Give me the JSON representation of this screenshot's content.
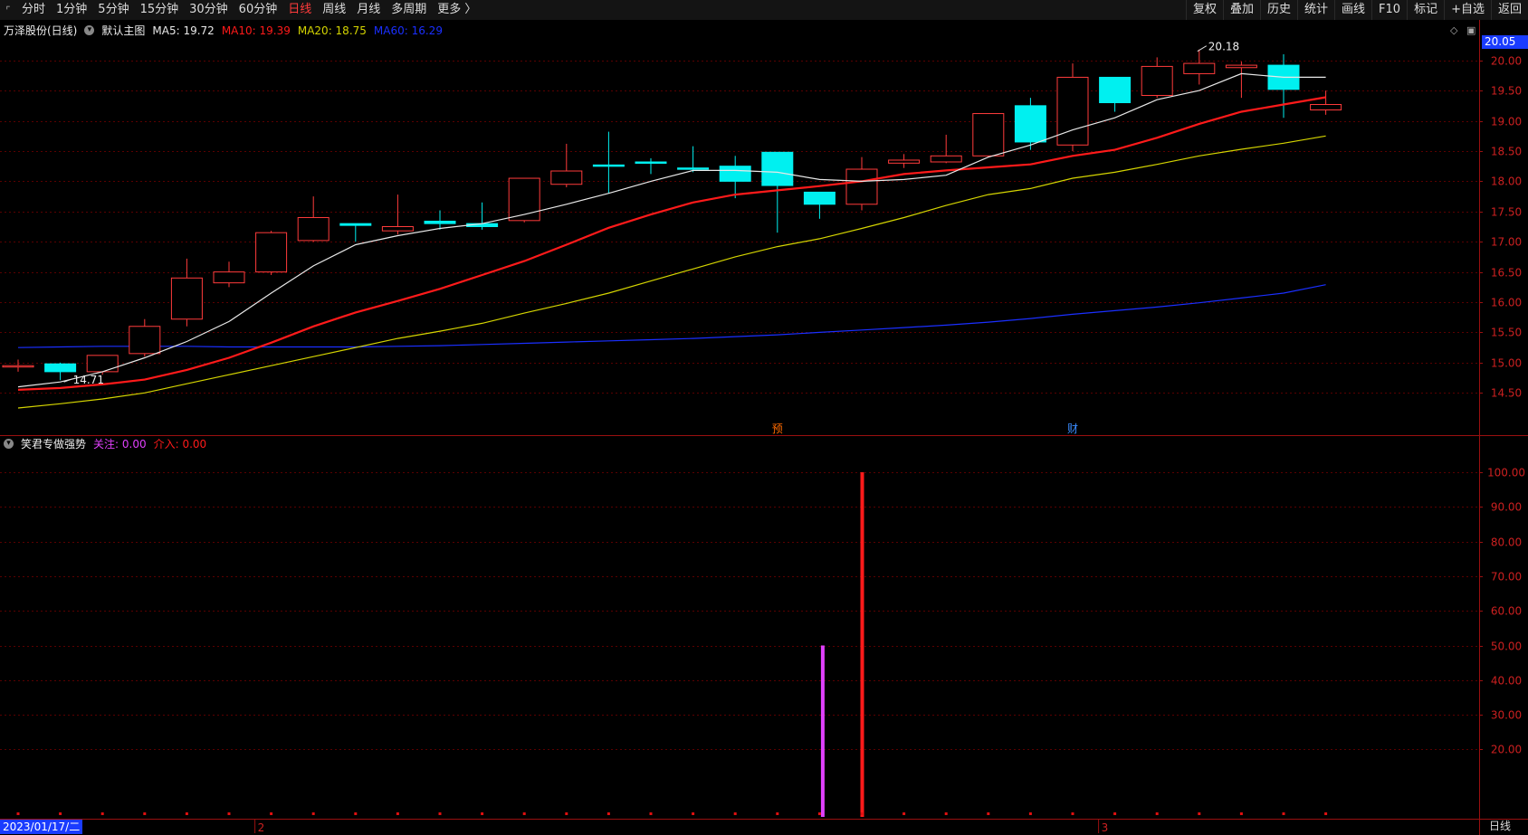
{
  "toolbar": {
    "periods": [
      "分时",
      "1分钟",
      "5分钟",
      "15分钟",
      "30分钟",
      "60分钟",
      "日线",
      "周线",
      "月线",
      "多周期",
      "更多 〉"
    ],
    "active_period": "日线",
    "right_buttons": [
      "复权",
      "叠加",
      "历史",
      "统计",
      "画线",
      "F10",
      "标记",
      "+自选",
      "返回"
    ]
  },
  "header": {
    "stock": "万泽股份(日线)",
    "main_label": "默认主图",
    "ma5": "MA5: 19.72",
    "ma10": "MA10: 19.39",
    "ma20": "MA20: 18.75",
    "ma60": "MA60: 16.29"
  },
  "indicator_header": {
    "name": "笑君专做强势",
    "guanzhu": "关注: 0.00",
    "jieru": "介入: 0.00"
  },
  "price_tag": "20.05",
  "date_tag": "2023/01/17/二",
  "period_label": "日线",
  "colors": {
    "up": "#ff3b3b",
    "down": "#00f0f0",
    "ma5": "#e8e8e8",
    "ma10": "#ff1a1a",
    "ma20": "#d4d400",
    "ma60": "#1a2fff",
    "guanzhu": "#e040fb",
    "jieru": "#ff1a1a",
    "axis": "#9a1010"
  },
  "chart_data": [
    {
      "type": "candlestick",
      "y_ticks": [
        "20.00",
        "19.50",
        "19.00",
        "18.50",
        "18.00",
        "17.50",
        "17.00",
        "16.50",
        "16.00",
        "15.50",
        "15.00",
        "14.50"
      ],
      "ylim": [
        14.1,
        20.4
      ],
      "candles": [
        {
          "o": 14.95,
          "h": 15.05,
          "l": 14.85,
          "c": 14.95
        },
        {
          "o": 14.98,
          "h": 15.0,
          "l": 14.71,
          "c": 14.85
        },
        {
          "o": 14.85,
          "h": 15.12,
          "l": 14.8,
          "c": 15.12
        },
        {
          "o": 15.15,
          "h": 15.72,
          "l": 15.1,
          "c": 15.6
        },
        {
          "o": 15.72,
          "h": 16.72,
          "l": 15.6,
          "c": 16.4
        },
        {
          "o": 16.32,
          "h": 16.67,
          "l": 16.25,
          "c": 16.5
        },
        {
          "o": 16.5,
          "h": 17.18,
          "l": 16.45,
          "c": 17.15
        },
        {
          "o": 17.02,
          "h": 17.75,
          "l": 17.0,
          "c": 17.4
        },
        {
          "o": 17.3,
          "h": 17.3,
          "l": 17.0,
          "c": 17.27
        },
        {
          "o": 17.18,
          "h": 17.78,
          "l": 17.12,
          "c": 17.25
        },
        {
          "o": 17.34,
          "h": 17.52,
          "l": 17.2,
          "c": 17.3
        },
        {
          "o": 17.3,
          "h": 17.65,
          "l": 17.2,
          "c": 17.25
        },
        {
          "o": 17.35,
          "h": 18.05,
          "l": 17.32,
          "c": 18.05
        },
        {
          "o": 17.95,
          "h": 18.62,
          "l": 17.9,
          "c": 18.17
        },
        {
          "o": 18.27,
          "h": 18.82,
          "l": 17.8,
          "c": 18.25
        },
        {
          "o": 18.32,
          "h": 18.38,
          "l": 18.12,
          "c": 18.3
        },
        {
          "o": 18.22,
          "h": 18.58,
          "l": 18.15,
          "c": 18.2
        },
        {
          "o": 18.25,
          "h": 18.42,
          "l": 17.72,
          "c": 18.0
        },
        {
          "o": 18.48,
          "h": 18.48,
          "l": 17.15,
          "c": 17.93
        },
        {
          "o": 17.82,
          "h": 17.82,
          "l": 17.38,
          "c": 17.62
        },
        {
          "o": 17.62,
          "h": 18.4,
          "l": 17.52,
          "c": 18.2
        },
        {
          "o": 18.3,
          "h": 18.45,
          "l": 18.22,
          "c": 18.35
        },
        {
          "o": 18.32,
          "h": 18.77,
          "l": 18.3,
          "c": 18.42
        },
        {
          "o": 18.42,
          "h": 19.12,
          "l": 18.4,
          "c": 19.12
        },
        {
          "o": 19.25,
          "h": 19.38,
          "l": 18.52,
          "c": 18.65
        },
        {
          "o": 18.6,
          "h": 19.95,
          "l": 18.5,
          "c": 19.72
        },
        {
          "o": 19.72,
          "h": 19.72,
          "l": 19.15,
          "c": 19.3
        },
        {
          "o": 19.42,
          "h": 20.05,
          "l": 19.38,
          "c": 19.9
        },
        {
          "o": 19.78,
          "h": 20.18,
          "l": 19.6,
          "c": 19.95
        },
        {
          "o": 19.88,
          "h": 19.98,
          "l": 19.38,
          "c": 19.92
        },
        {
          "o": 19.92,
          "h": 20.1,
          "l": 19.05,
          "c": 19.52
        },
        {
          "o": 19.18,
          "h": 19.5,
          "l": 19.1,
          "c": 19.27
        }
      ],
      "ma5": [
        14.6,
        14.68,
        14.85,
        15.08,
        15.35,
        15.68,
        16.15,
        16.6,
        16.95,
        17.1,
        17.22,
        17.3,
        17.45,
        17.62,
        17.8,
        18.0,
        18.18,
        18.18,
        18.15,
        18.03,
        18.0,
        18.03,
        18.1,
        18.4,
        18.6,
        18.85,
        19.05,
        19.35,
        19.5,
        19.78,
        19.72,
        19.72
      ],
      "ma10": [
        14.55,
        14.58,
        14.64,
        14.72,
        14.88,
        15.08,
        15.33,
        15.6,
        15.83,
        16.02,
        16.22,
        16.45,
        16.68,
        16.95,
        17.23,
        17.45,
        17.65,
        17.78,
        17.85,
        17.92,
        18.0,
        18.12,
        18.18,
        18.23,
        18.28,
        18.42,
        18.52,
        18.72,
        18.95,
        19.15,
        19.27,
        19.39
      ],
      "ma20": [
        14.25,
        14.32,
        14.4,
        14.5,
        14.65,
        14.8,
        14.95,
        15.1,
        15.25,
        15.4,
        15.52,
        15.65,
        15.82,
        15.98,
        16.15,
        16.35,
        16.55,
        16.75,
        16.92,
        17.05,
        17.22,
        17.4,
        17.6,
        17.78,
        17.88,
        18.05,
        18.15,
        18.28,
        18.42,
        18.53,
        18.63,
        18.75
      ],
      "ma60": [
        15.25,
        15.26,
        15.27,
        15.27,
        15.27,
        15.26,
        15.26,
        15.26,
        15.26,
        15.27,
        15.28,
        15.3,
        15.32,
        15.34,
        15.36,
        15.38,
        15.4,
        15.43,
        15.46,
        15.5,
        15.54,
        15.58,
        15.62,
        15.67,
        15.73,
        15.8,
        15.86,
        15.92,
        15.99,
        16.07,
        16.15,
        16.29
      ],
      "annotations": [
        {
          "index": 1,
          "text": "14.71",
          "at": "low"
        },
        {
          "index": 28,
          "text": "20.18",
          "at": "high"
        }
      ],
      "event_marks": [
        {
          "index": 18,
          "text": "预",
          "color": "#ff6a00"
        },
        {
          "index": 25,
          "text": "财",
          "color": "#3a8cff"
        }
      ]
    },
    {
      "type": "bar",
      "title": "笑君专做强势",
      "y_ticks": [
        "100.00",
        "90.00",
        "80.00",
        "70.00",
        "60.00",
        "50.00",
        "40.00",
        "30.00",
        "20.00"
      ],
      "ylim": [
        0,
        100
      ],
      "series": [
        {
          "name": "关注",
          "index": [
            19
          ],
          "values": [
            50
          ]
        },
        {
          "name": "介入",
          "index": [
            20
          ],
          "values": [
            100
          ]
        }
      ]
    }
  ],
  "x_axis": {
    "month_marks": [
      {
        "index": 6,
        "text": "2"
      },
      {
        "index": 26,
        "text": "3"
      }
    ]
  }
}
